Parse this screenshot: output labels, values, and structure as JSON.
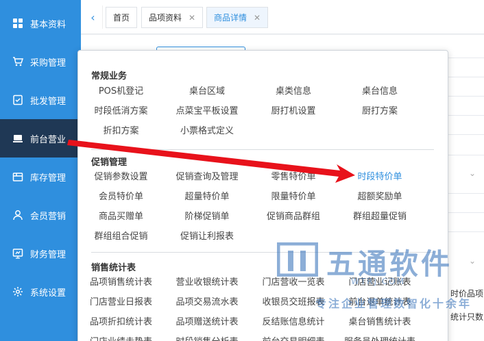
{
  "sidebar": {
    "items": [
      {
        "label": "基本资料",
        "icon": "grid-icon",
        "active": false
      },
      {
        "label": "采购管理",
        "icon": "cart-icon",
        "active": false
      },
      {
        "label": "批发管理",
        "icon": "checklist-icon",
        "active": false
      },
      {
        "label": "前台营业",
        "icon": "cashier-icon",
        "active": true
      },
      {
        "label": "库存管理",
        "icon": "inventory-icon",
        "active": false
      },
      {
        "label": "会员营销",
        "icon": "user-icon",
        "active": false
      },
      {
        "label": "财务管理",
        "icon": "finance-icon",
        "active": false
      },
      {
        "label": "系统设置",
        "icon": "gear-icon",
        "active": false
      }
    ]
  },
  "tabs": [
    {
      "label": "首页",
      "closable": false,
      "active": false
    },
    {
      "label": "品项资料",
      "closable": true,
      "active": false
    },
    {
      "label": "商品详情",
      "closable": true,
      "active": true
    }
  ],
  "background": {
    "right_text_1": "时价品项",
    "right_text_2": "统计只数"
  },
  "menu": {
    "sections": [
      {
        "title": "常规业务",
        "items": [
          "POS机登记",
          "桌台区域",
          "桌类信息",
          "桌台信息",
          "时段低消方案",
          "点菜宝平板设置",
          "厨打机设置",
          "厨打方案",
          "折扣方案",
          "小票格式定义"
        ]
      },
      {
        "title": "促销管理",
        "items": [
          "促销参数设置",
          "促销查询及管理",
          "零售特价单",
          "时段特价单",
          "会员特价单",
          "超量特价单",
          "限量特价单",
          "超额奖励单",
          "商品买赠单",
          "阶梯促销单",
          "促销商品群组",
          "群组超量促销",
          "群组组合促销",
          "促销让利报表"
        ]
      },
      {
        "title": "销售统计表",
        "items": [
          "品项销售统计表",
          "营业收银统计表",
          "门店营收一览表",
          "门店营业记账表",
          "门店营业日报表",
          "品项交易流水表",
          "收银员交班报表",
          "前台退单统计表",
          "品项折扣统计表",
          "品项赠送统计表",
          "反结账信息统计",
          "桌台销售统计表",
          "门店业绩走势表",
          "时段销售分析表",
          "前台交易明细表",
          "服务员处理统计表"
        ]
      }
    ],
    "highlighted": "时段特价单"
  },
  "watermark": {
    "brand": "五通软件",
    "url": "WTRJ.COM",
    "slogan": "专注企业管理数智化十余年"
  },
  "colors": {
    "sidebar": "#2f8fde",
    "sidebar_active": "#1f3855",
    "accent": "#2f8fde",
    "arrow": "#e8121b"
  }
}
